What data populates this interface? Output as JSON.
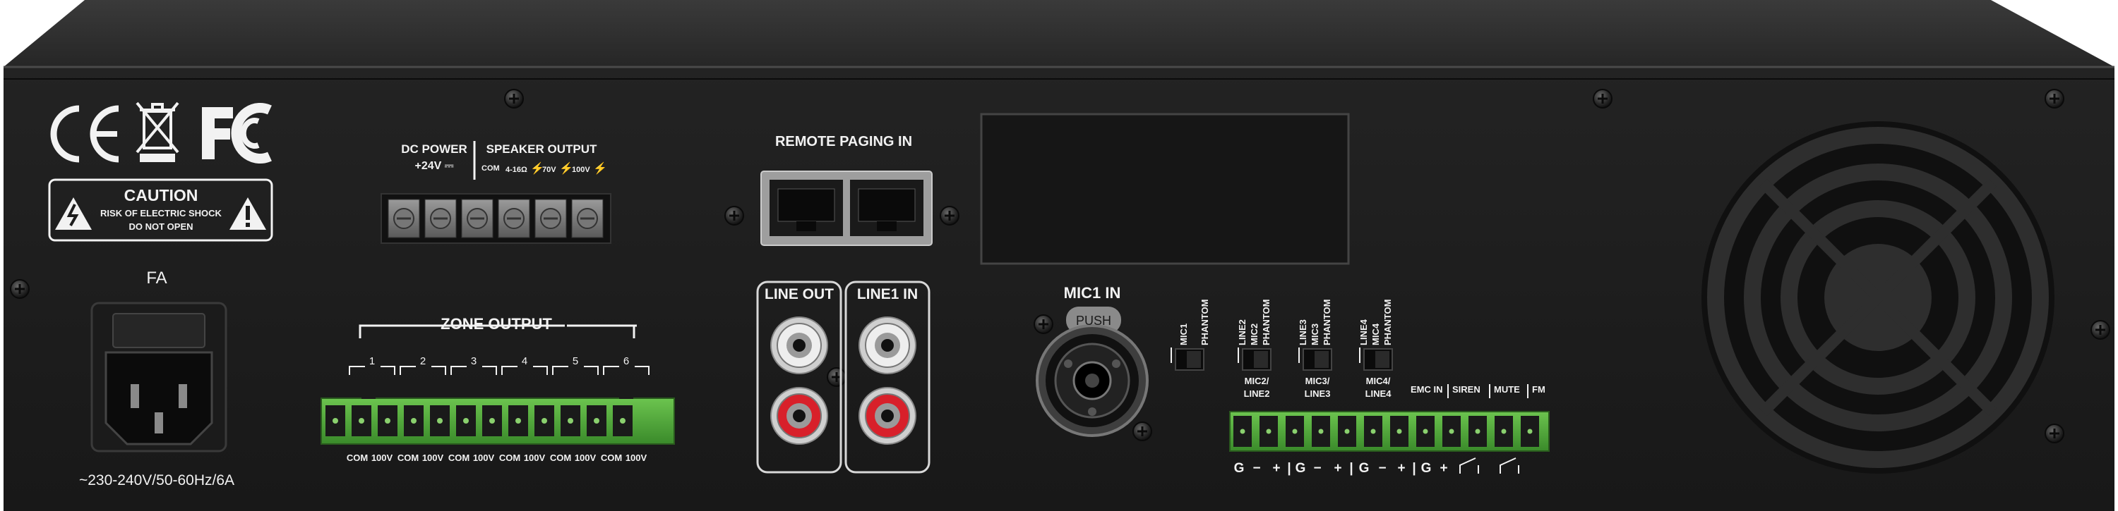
{
  "certifications": {
    "ce": "CE",
    "fc": "FC"
  },
  "caution": {
    "title": "CAUTION",
    "line1": "RISK OF ELECTRIC SHOCK",
    "line2": "DO NOT OPEN"
  },
  "fuse_label": "FA",
  "power_rating": "~230-240V/50-60Hz/6A",
  "dc_power": {
    "title": "DC POWER",
    "voltage": "+24V"
  },
  "speaker_output": {
    "title": "SPEAKER OUTPUT",
    "com": "COM",
    "ohm": "4-16Ω",
    "v70": "70V",
    "v100": "100V"
  },
  "remote_paging": "REMOTE PAGING IN",
  "zone_output": {
    "title": "ZONE OUTPUT",
    "zones": [
      "1",
      "2",
      "3",
      "4",
      "5",
      "6"
    ],
    "terminals": [
      "COM",
      "100V",
      "COM",
      "100V",
      "COM",
      "100V",
      "COM",
      "100V",
      "COM",
      "100V",
      "COM",
      "100V"
    ]
  },
  "line_out": "LINE OUT",
  "line1_in": "LINE1 IN",
  "mic1_in": "MIC1 IN",
  "push": "PUSH",
  "switches": {
    "mic1": "MIC1",
    "phantom": "PHANTOM",
    "line2": "LINE2",
    "mic2": "MIC2",
    "line3": "LINE3",
    "mic3": "MIC3",
    "line4": "LINE4",
    "mic4": "MIC4"
  },
  "input_groups": {
    "g2a": "MIC2/",
    "g2b": "LINE2",
    "g3a": "MIC3/",
    "g3b": "LINE3",
    "g4a": "MIC4/",
    "g4b": "LINE4"
  },
  "control": {
    "emc": "EMC IN",
    "siren": "SIREN",
    "mute": "MUTE",
    "fm": "FM"
  },
  "terminal_markings": [
    "G",
    "−",
    "+",
    "|",
    "G",
    "−",
    "+",
    "|",
    "G",
    "−",
    "+",
    "|",
    "G",
    "+"
  ],
  "colors": {
    "chassis": "#2b2b2b",
    "panel": "#1d1d1d",
    "terminal_green": "#4fae3b",
    "rca_red": "#d8202a",
    "rca_white": "#eeeeee",
    "label": "#f2f2f2"
  }
}
